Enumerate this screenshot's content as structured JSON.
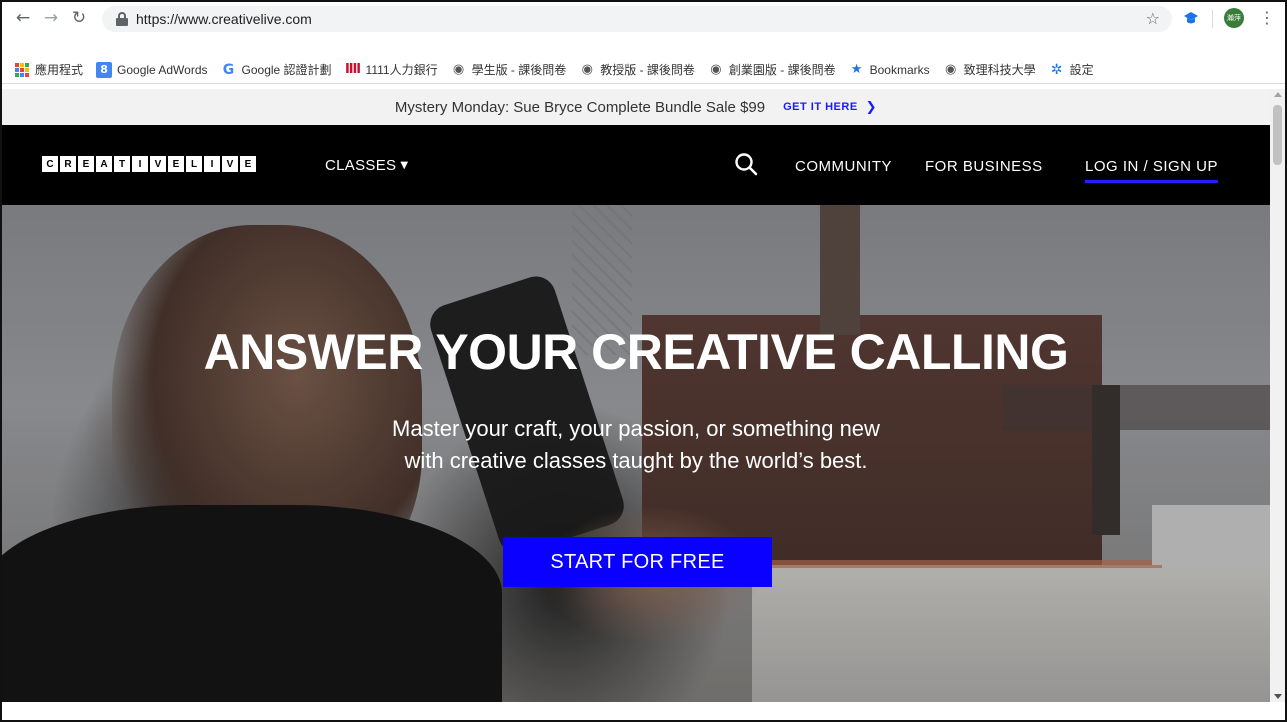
{
  "browser": {
    "url": "https://www.creativelive.com",
    "avatar_text": "瀚萍",
    "icons": {
      "back": "back-arrow-icon",
      "forward": "forward-arrow-icon",
      "reload": "reload-icon",
      "star": "bookmark-star-icon",
      "menu": "kebab-menu-icon"
    }
  },
  "bookmarks": [
    {
      "label": "應用程式",
      "icon": "apps-grid-icon"
    },
    {
      "label": "Google AdWords",
      "icon": "adwords-icon"
    },
    {
      "label": "Google 認證計劃",
      "icon": "google-icon"
    },
    {
      "label": "1111人力銀行",
      "icon": "1111-icon"
    },
    {
      "label": "學生版 - 課後問卷",
      "icon": "globe-icon"
    },
    {
      "label": "教授版 - 課後問卷",
      "icon": "globe-icon"
    },
    {
      "label": "創業園版 - 課後問卷",
      "icon": "globe-icon"
    },
    {
      "label": "Bookmarks",
      "icon": "star-icon"
    },
    {
      "label": "致理科技大學",
      "icon": "globe-icon"
    },
    {
      "label": "設定",
      "icon": "gear-icon"
    }
  ],
  "promo": {
    "text": "Mystery Monday: Sue Bryce Complete Bundle Sale $99",
    "cta": "GET IT HERE"
  },
  "header": {
    "logo_letters": [
      "C",
      "R",
      "E",
      "A",
      "T",
      "I",
      "V",
      "E",
      "L",
      "I",
      "V",
      "E"
    ],
    "classes": "CLASSES",
    "community": "COMMUNITY",
    "for_business": "FOR BUSINESS",
    "login": "LOG IN / SIGN UP"
  },
  "hero": {
    "title": "ANSWER YOUR CREATIVE CALLING",
    "subtitle_line1": "Master your craft, your passion, or something new",
    "subtitle_line2": "with creative classes taught by the world’s best.",
    "cta": "START FOR FREE"
  },
  "colors": {
    "accent_blue": "#0a00ff",
    "header_bg": "#000000",
    "promo_bg": "#f2f2f2",
    "cta_link": "#1a1aff"
  }
}
